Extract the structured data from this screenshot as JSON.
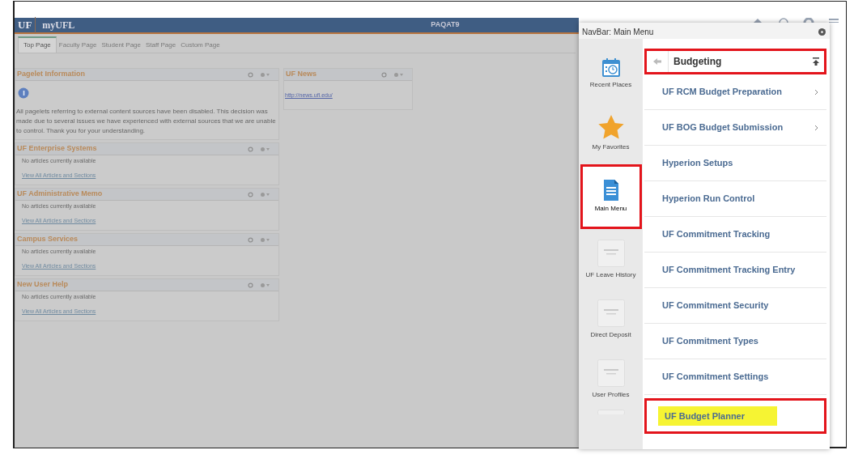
{
  "header": {
    "logo": "UF",
    "title": "myUFL",
    "environment": "PAQAT9"
  },
  "tabs": [
    {
      "label": "Top Page",
      "selected": true
    },
    {
      "label": "Faculty Page",
      "selected": false
    },
    {
      "label": "Student Page",
      "selected": false
    },
    {
      "label": "Staff Page",
      "selected": false
    },
    {
      "label": "Custom Page",
      "selected": false
    }
  ],
  "pagelets_left": [
    {
      "title": "Pagelet Information",
      "kind": "info",
      "text": "All pagelets referring to external content sources have been disabled. This decision was made due to several issues we have experienced with external sources that we are unable to control. Thank you for your understanding."
    },
    {
      "title": "UF Enterprise Systems",
      "kind": "articles",
      "text": "No articles currently available",
      "link": "View All Articles and Sections"
    },
    {
      "title": "UF Administrative Memo",
      "kind": "articles",
      "text": "No articles currently available",
      "link": "View All Articles and Sections"
    },
    {
      "title": "Campus Services",
      "kind": "articles",
      "text": "No articles currently available",
      "link": "View All Articles and Sections"
    },
    {
      "title": "New User Help",
      "kind": "articles",
      "text": "No articles currently available",
      "link": "View All Articles and Sections"
    }
  ],
  "pagelets_right": [
    {
      "title": "UF News",
      "kind": "link",
      "link": "http://news.ufl.edu/"
    }
  ],
  "navbar": {
    "title": "NavBar: Main Menu",
    "tiles": [
      {
        "label": "Recent Places",
        "kind": "recent",
        "selected": false,
        "marked": false
      },
      {
        "label": "My Favorites",
        "kind": "favorites",
        "selected": false,
        "marked": false
      },
      {
        "label": "Main Menu",
        "kind": "menu",
        "selected": true,
        "marked": true
      },
      {
        "label": "UF Leave History",
        "kind": "placeholder",
        "selected": false,
        "marked": false
      },
      {
        "label": "Direct Deposit",
        "kind": "placeholder",
        "selected": false,
        "marked": false
      },
      {
        "label": "User Profiles",
        "kind": "placeholder",
        "selected": false,
        "marked": false
      }
    ],
    "breadcrumb": {
      "label": "Budgeting",
      "marked": true
    },
    "items": [
      {
        "label": "UF RCM Budget Preparation",
        "submenu": true,
        "marked": false,
        "highlighted": false
      },
      {
        "label": "UF BOG Budget Submission",
        "submenu": true,
        "marked": false,
        "highlighted": false
      },
      {
        "label": "Hyperion Setups",
        "submenu": false,
        "marked": false,
        "highlighted": false
      },
      {
        "label": "Hyperion Run Control",
        "submenu": false,
        "marked": false,
        "highlighted": false
      },
      {
        "label": "UF Commitment Tracking",
        "submenu": false,
        "marked": false,
        "highlighted": false
      },
      {
        "label": "UF Commitment Tracking Entry",
        "submenu": false,
        "marked": false,
        "highlighted": false
      },
      {
        "label": "UF Commitment Security",
        "submenu": false,
        "marked": false,
        "highlighted": false
      },
      {
        "label": "UF Commitment Types",
        "submenu": false,
        "marked": false,
        "highlighted": false
      },
      {
        "label": "UF Commitment Settings",
        "submenu": false,
        "marked": false,
        "highlighted": false
      },
      {
        "label": "UF Budget Planner",
        "submenu": false,
        "marked": true,
        "highlighted": true
      }
    ]
  }
}
